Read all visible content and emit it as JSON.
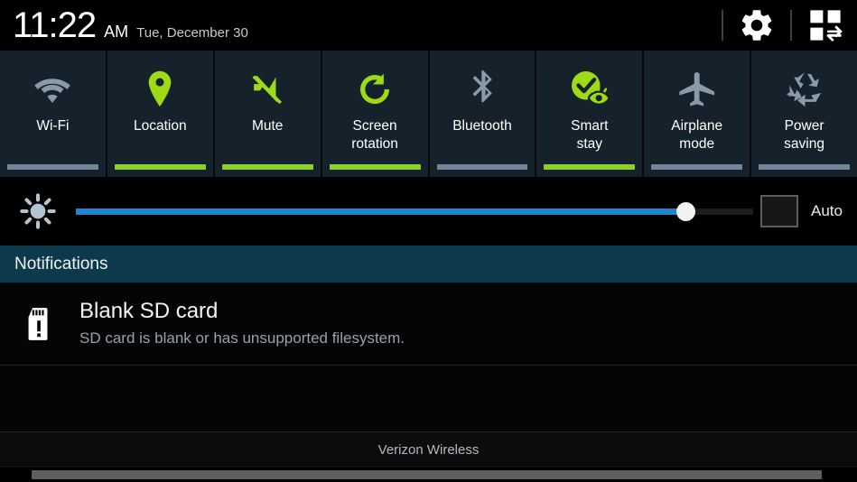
{
  "statusbar": {
    "time": "11:22",
    "ampm": "AM",
    "date": "Tue, December 30",
    "icons": [
      {
        "name": "settings-gear-icon",
        "label": "Settings"
      },
      {
        "name": "quick-settings-grid-icon",
        "label": "Toggle quick settings"
      }
    ]
  },
  "quick_settings": {
    "panel_bg": "#15222c",
    "on_color": "#8dcf2b",
    "off_color": "#74879a",
    "tiles": [
      {
        "label": "Wi-Fi",
        "icon": "wifi-icon",
        "state": "off"
      },
      {
        "label": "Location",
        "icon": "location-pin-icon",
        "state": "on"
      },
      {
        "label": "Mute",
        "icon": "mute-speaker-icon",
        "state": "on"
      },
      {
        "label": "Screen\nrotation",
        "icon": "screen-rotation-icon",
        "state": "on"
      },
      {
        "label": "Bluetooth",
        "icon": "bluetooth-icon",
        "state": "off"
      },
      {
        "label": "Smart\nstay",
        "icon": "smart-stay-eye-icon",
        "state": "on"
      },
      {
        "label": "Airplane\nmode",
        "icon": "airplane-icon",
        "state": "off"
      },
      {
        "label": "Power\nsaving",
        "icon": "power-saving-recycle-icon",
        "state": "off"
      }
    ]
  },
  "brightness": {
    "icon": "brightness-sun-icon",
    "value_percent": 90,
    "fill_color": "#1f86cd",
    "auto_label": "Auto",
    "auto_checked": false
  },
  "notifications": {
    "header": "Notifications",
    "items": [
      {
        "icon": "sd-card-warning-icon",
        "title": "Blank SD card",
        "subtitle": "SD card is blank or has unsupported filesystem."
      }
    ]
  },
  "footer": {
    "carrier": "Verizon Wireless",
    "handle": "drag-handle"
  }
}
